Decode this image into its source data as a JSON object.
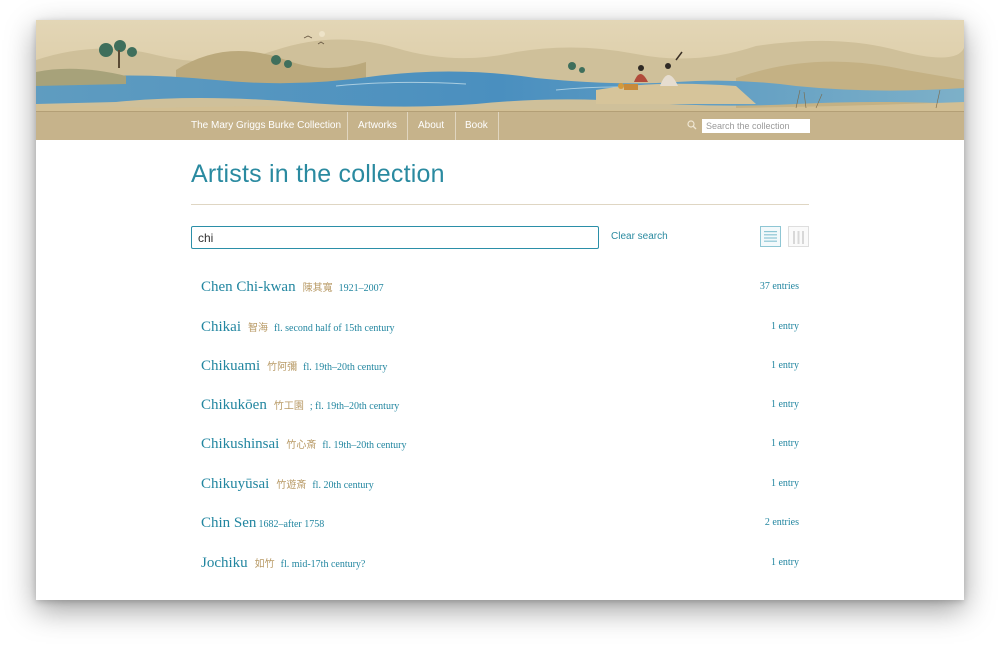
{
  "nav": {
    "brand": "The Mary Griggs Burke Collection",
    "items": [
      {
        "label": "Artworks"
      },
      {
        "label": "About"
      },
      {
        "label": "Book"
      }
    ],
    "search_placeholder": "Search the collection"
  },
  "main": {
    "title": "Artists in the collection",
    "filter_value": "chi",
    "clear_label": "Clear search"
  },
  "artists": [
    {
      "name": "Chen Chi-kwan",
      "native": "陳其寬",
      "dates": "1921–2007",
      "entries": "37 entries"
    },
    {
      "name": "Chikai",
      "native": "智海",
      "dates": "fl. second half of 15th century",
      "entries": "1 entry"
    },
    {
      "name": "Chikuami",
      "native": "竹阿彌",
      "dates": "fl. 19th–20th century",
      "entries": "1 entry"
    },
    {
      "name": "Chikukōen",
      "native": "竹工園",
      "dates": "; fl. 19th–20th century",
      "entries": "1 entry"
    },
    {
      "name": "Chikushinsai",
      "native": "竹心斎",
      "dates": "fl. 19th–20th century",
      "entries": "1 entry"
    },
    {
      "name": "Chikuyūsai",
      "native": "竹遊斎",
      "dates": "fl. 20th century",
      "entries": "1 entry"
    },
    {
      "name": "Chin Sen",
      "native": "",
      "dates": "1682–after 1758",
      "entries": "2 entries"
    },
    {
      "name": "Jochiku",
      "native": "如竹",
      "dates": "fl. mid-17th century?",
      "entries": "1 entry"
    }
  ],
  "colors": {
    "accent": "#2286a0",
    "nav_bar": "#c6b38b",
    "native_text": "#b89a66"
  }
}
